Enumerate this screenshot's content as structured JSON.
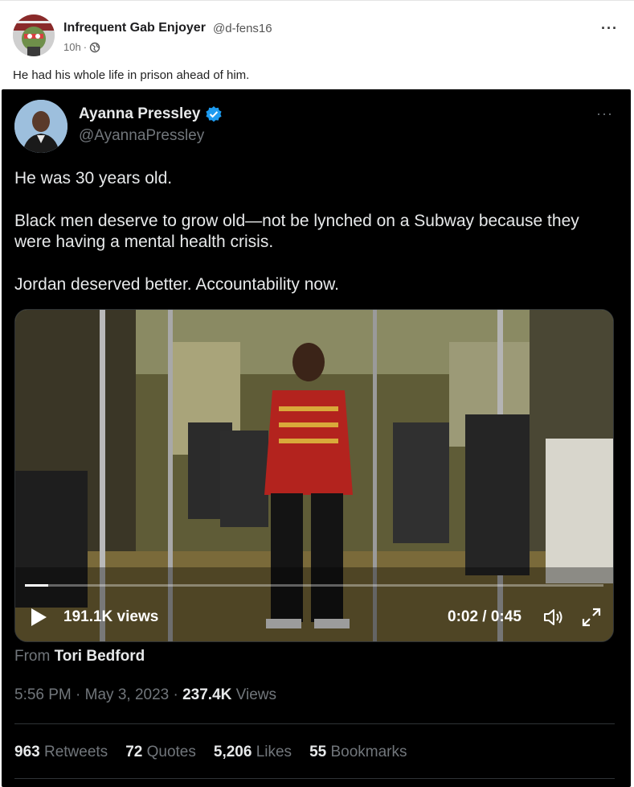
{
  "post": {
    "author_name": "Infrequent Gab Enjoyer",
    "author_handle": "@d-fens16",
    "time": "10h",
    "separator": "·",
    "more": "···",
    "text": "He had his whole life in prison ahead of him."
  },
  "embed": {
    "name": "Ayanna Pressley",
    "handle": "@AyannaPressley",
    "more": "···",
    "lines": [
      "He was 30 years old.",
      "Black men deserve to grow old—not be lynched on a Subway because they were having a mental health crisis.",
      "Jordan deserved better. Accountability now."
    ],
    "video": {
      "views": "191.1K views",
      "time": "0:02 / 0:45",
      "progress": 0.04
    },
    "from_prefix": "From",
    "from_name": "Tori Bedford",
    "timestamp_prefix": "5:56 PM · May 3, 2023 ·",
    "view_count": "237.4K",
    "view_label": "Views",
    "stats": [
      {
        "value": "963",
        "label": "Retweets"
      },
      {
        "value": "72",
        "label": "Quotes"
      },
      {
        "value": "5,206",
        "label": "Likes"
      },
      {
        "value": "55",
        "label": "Bookmarks"
      }
    ]
  },
  "colors": {
    "embed_bg": "#000000",
    "verified": "#1d9bf0",
    "muted": "#71767b"
  }
}
